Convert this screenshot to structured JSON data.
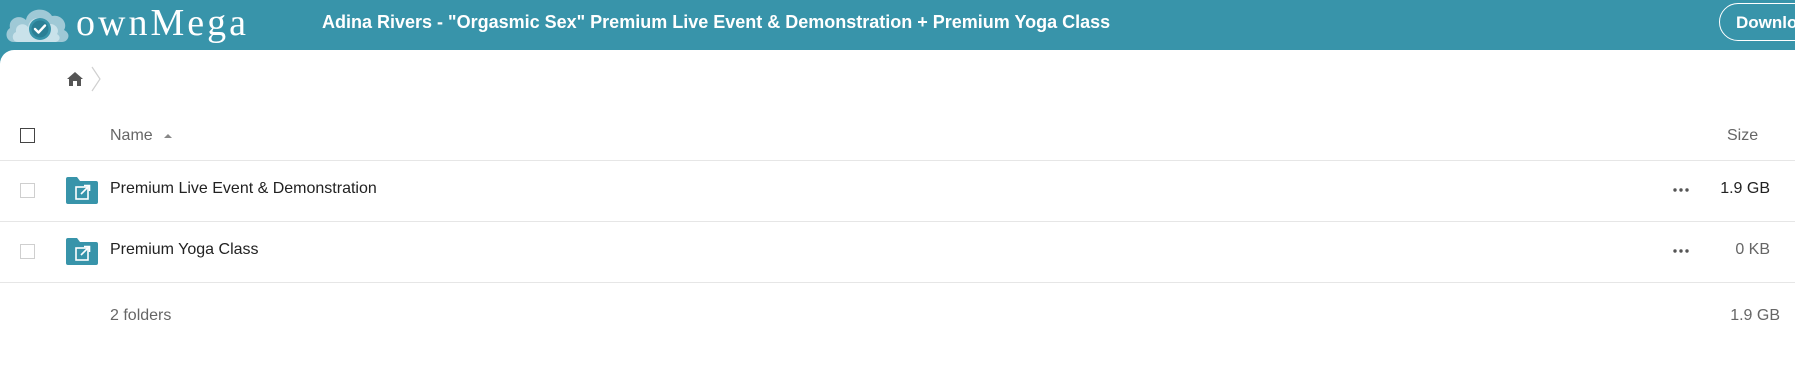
{
  "header": {
    "logo_text": "ownMega",
    "title": "Adina Rivers - \"Orgasmic Sex\" Premium Live Event & Demonstration + Premium Yoga Class",
    "download_label": "Download",
    "background_color": "#3894aa"
  },
  "breadcrumb": {
    "home_icon": "home-icon",
    "separator_icon": "chevron-right-icon"
  },
  "table": {
    "columns": {
      "name": "Name",
      "size": "Size"
    },
    "sort": "name-ascending",
    "rows": [
      {
        "icon": "shared-folder-icon",
        "name": "Premium Live Event & Demonstration",
        "size": "1.9 GB"
      },
      {
        "icon": "shared-folder-icon",
        "name": "Premium Yoga Class",
        "size": "0 KB"
      }
    ]
  },
  "footer": {
    "count": "2 folders",
    "total_size": "1.9 GB"
  }
}
